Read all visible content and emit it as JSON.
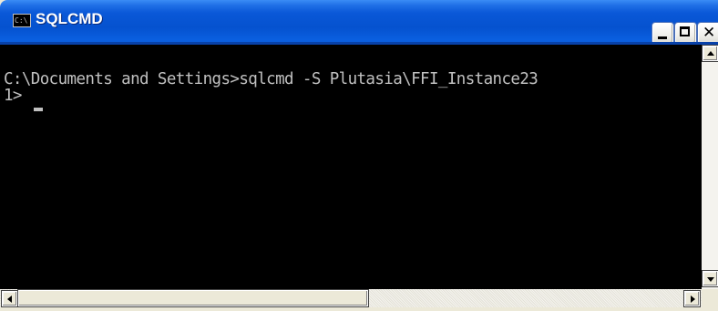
{
  "window": {
    "title": "SQLCMD",
    "icon": "console-icon",
    "icon_text": "C:\\",
    "colors": {
      "titlebar": "#0552cf",
      "console_bg": "#000000",
      "console_text": "#c0c0c0"
    }
  },
  "title_buttons": {
    "minimize_icon": "minimize-icon",
    "maximize_icon": "maximize-icon",
    "close_icon": "close-icon",
    "close_glyph": "✕"
  },
  "console": {
    "lines": [
      "C:\\Documents and Settings>sqlcmd -S Plutasia\\FFI_Instance23",
      "1> "
    ]
  },
  "scrollbars": {
    "vertical": {
      "up_icon": "scroll-up-arrow-icon",
      "down_icon": "scroll-down-arrow-icon"
    },
    "horizontal": {
      "left_icon": "scroll-left-arrow-icon",
      "right_icon": "scroll-right-arrow-icon"
    }
  }
}
